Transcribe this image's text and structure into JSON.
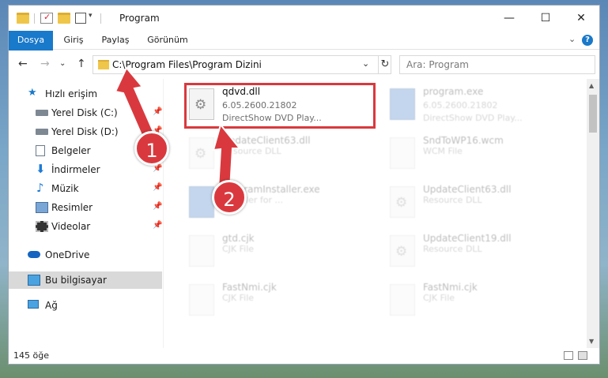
{
  "window": {
    "title": "Program",
    "minimize": "—",
    "maximize": "☐",
    "close": "✕"
  },
  "ribbon": {
    "tabs": [
      "Dosya",
      "Giriş",
      "Paylaş",
      "Görünüm"
    ],
    "expand": "⌄",
    "help": "?"
  },
  "nav": {
    "back": "←",
    "forward": "→",
    "recent": "⌄",
    "up": "↑",
    "address": "C:\\Program Files\\Program Dizini",
    "address_dropdown": "⌄",
    "refresh": "↻",
    "search_placeholder": "Ara: Program"
  },
  "sidebar": {
    "items": [
      {
        "label": "Hızlı erişim",
        "icon": "star-icon",
        "pinned": false
      },
      {
        "label": "Yerel Disk (C:)",
        "icon": "drive-icon",
        "pinned": true
      },
      {
        "label": "Yerel Disk (D:)",
        "icon": "drive-icon",
        "pinned": true
      },
      {
        "label": "Belgeler",
        "icon": "document-icon",
        "pinned": true
      },
      {
        "label": "İndirmeler",
        "icon": "download-icon",
        "pinned": true
      },
      {
        "label": "Müzik",
        "icon": "music-icon",
        "pinned": true
      },
      {
        "label": "Resimler",
        "icon": "pictures-icon",
        "pinned": true
      },
      {
        "label": "Videolar",
        "icon": "video-icon",
        "pinned": true
      },
      {
        "label": "OneDrive",
        "icon": "cloud-icon",
        "pinned": false
      },
      {
        "label": "Bu bilgisayar",
        "icon": "computer-icon",
        "pinned": false
      },
      {
        "label": "Ağ",
        "icon": "network-icon",
        "pinned": false
      }
    ]
  },
  "files": [
    {
      "name": "qdvd.dll",
      "line2": "6.05.2600.21802",
      "line3": "DirectShow DVD Play...",
      "icon": "gear-file-icon"
    },
    {
      "name": "program.exe",
      "line2": "6.05.2600.21802",
      "line3": "DirectShow DVD Play...",
      "icon": "exe-file-icon"
    },
    {
      "name": "UpdateClient63.dll",
      "line2": "Resource DLL",
      "icon": "gear-file-icon"
    },
    {
      "name": "SndToWP16.wcm",
      "line2": "WCM File",
      "icon": "blank-file-icon"
    },
    {
      "name": "programInstaller.exe",
      "line2": "Installer for ...",
      "icon": "exe-file-icon"
    },
    {
      "name": "UpdateClient63.dll",
      "line2": "Resource DLL",
      "icon": "gear-file-icon"
    },
    {
      "name": "gtd.cjk",
      "line2": "CJK File",
      "icon": "blank-file-icon"
    },
    {
      "name": "UpdateClient19.dll",
      "line2": "Resource DLL",
      "icon": "gear-file-icon"
    },
    {
      "name": "FastNmi.cjk",
      "line2": "CJK File",
      "icon": "blank-file-icon"
    },
    {
      "name": "FastNmi.cjk",
      "line2": "CJK File",
      "icon": "blank-file-icon"
    }
  ],
  "status": {
    "count": "145 öğe"
  },
  "annotations": {
    "step1": "1",
    "step2": "2",
    "highlight_color": "#d9393e"
  }
}
